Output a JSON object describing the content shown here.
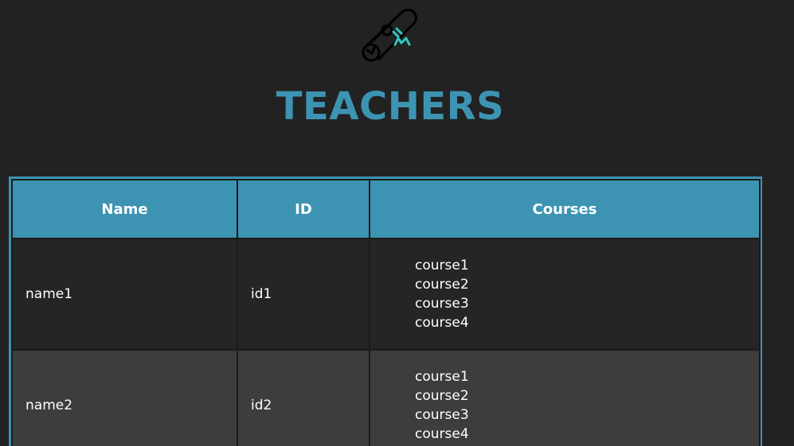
{
  "header": {
    "title": "TEACHERS",
    "logo_icon": "diploma-scroll-icon",
    "title_color": "#3d94b2",
    "accent_color": "#2fc7c5"
  },
  "table": {
    "columns": [
      "Name",
      "ID",
      "Courses"
    ],
    "rows": [
      {
        "name": "name1",
        "id": "id1",
        "courses": [
          "course1",
          "course2",
          "course3",
          "course4"
        ]
      },
      {
        "name": "name2",
        "id": "id2",
        "courses": [
          "course1",
          "course2",
          "course3",
          "course4"
        ]
      }
    ]
  }
}
